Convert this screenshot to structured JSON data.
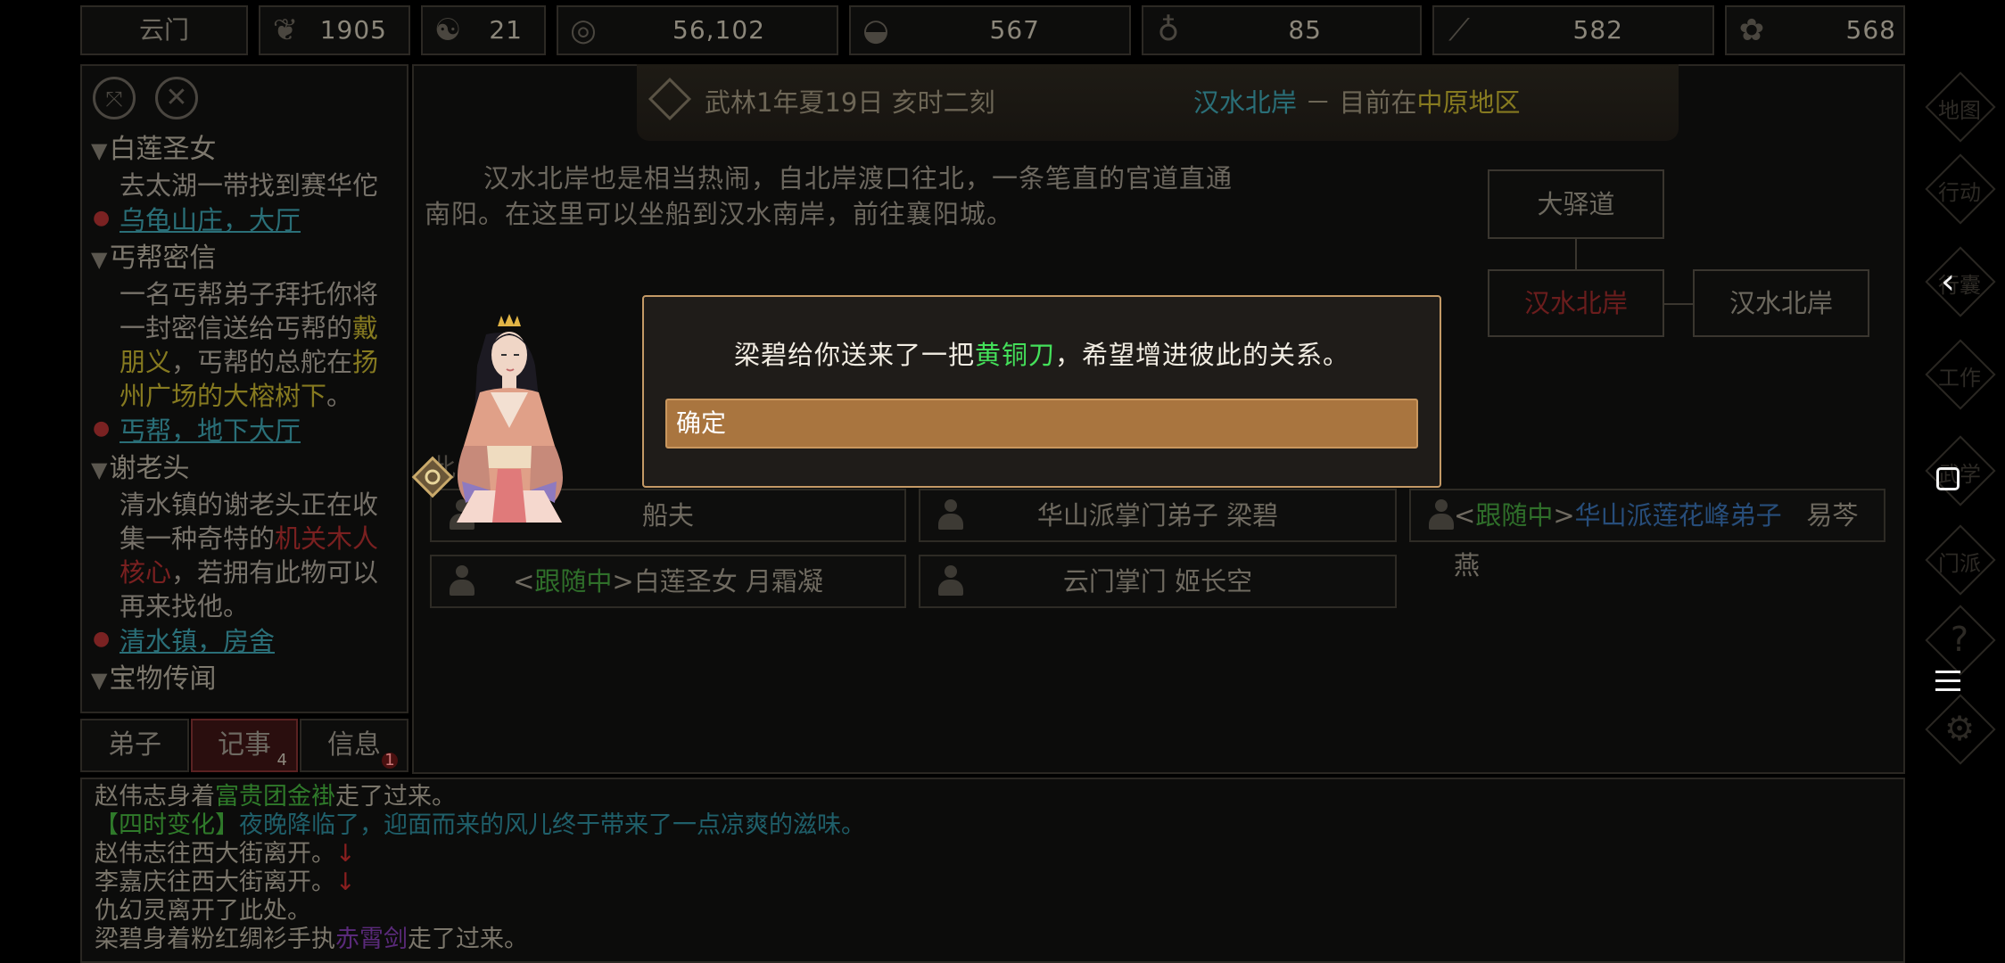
{
  "topbar": {
    "sect_name": "云门",
    "resources": [
      {
        "icon": "reputation-icon",
        "value": "1905"
      },
      {
        "icon": "yin-yang-icon",
        "value": "21"
      },
      {
        "icon": "coin-icon",
        "value": "56,102"
      },
      {
        "icon": "food-bowl-icon",
        "value": "567"
      },
      {
        "icon": "gourd-icon",
        "value": "85"
      },
      {
        "icon": "wood-icon",
        "value": "582"
      },
      {
        "icon": "ore-icon",
        "value": "568"
      }
    ]
  },
  "left_panel": {
    "quests": [
      {
        "title": "白莲圣女",
        "desc": "去太湖一带找到赛华佗",
        "location": "乌龟山庄，大厅"
      },
      {
        "title": "丐帮密信",
        "desc_parts": [
          "一名丐帮弟子拜托你将一封密信送给丐帮的",
          "戴朋义",
          "，丐帮的总舵在",
          "扬州广场的大榕树下",
          "。"
        ],
        "location": "丐帮，地下大厅"
      },
      {
        "title": "谢老头",
        "desc_parts": [
          "清水镇的谢老头正在收集一种奇特的",
          "机关木人核心",
          "，若拥有此物可以再来找他。"
        ],
        "location": "清水镇，房舍"
      },
      {
        "title": "宝物传闻"
      }
    ]
  },
  "tabs": [
    {
      "label": "弟子",
      "badge": ""
    },
    {
      "label": "记事",
      "badge": "4"
    },
    {
      "label": "信息",
      "badge": "1"
    }
  ],
  "header": {
    "date": "武林1年夏19日 亥时二刻",
    "location": "汉水北岸",
    "separator": "－",
    "region_prefix": "目前在",
    "region": "中原地区"
  },
  "description": "汉水北岸也是相当热闹，自北岸渡口往北，一条笔直的官道直通南阳。在这里可以坐船到汉水南岸，前往襄阳城。",
  "map": {
    "north": "大驿道",
    "current": "汉水北岸",
    "east": "汉水北岸"
  },
  "section_label": "此",
  "npcs": [
    {
      "prefix": "",
      "tag": "",
      "faction": "",
      "name": "船夫"
    },
    {
      "prefix": "",
      "tag": "",
      "faction": "",
      "name": "华山派掌门弟子 梁碧"
    },
    {
      "prefix": "<",
      "tag": "跟随中",
      "faction": "华山派莲花峰弟子",
      "name": "易芩燕"
    },
    {
      "prefix": "<",
      "tag": "跟随中",
      "faction": "",
      "name": "白莲圣女 月霜凝"
    },
    {
      "prefix": "",
      "tag": "",
      "faction": "",
      "name": "云门掌门 姬长空"
    }
  ],
  "dialog": {
    "message_before": "梁碧给你送来了一把",
    "item": "黄铜刀",
    "message_after": "，希望增进彼此的关系。",
    "confirm_label": "确定"
  },
  "log": [
    {
      "parts": [
        [
          "赵伟志身着",
          ""
        ],
        [
          "富贵团金褂",
          "green"
        ],
        [
          "走了过来。",
          ""
        ]
      ]
    },
    {
      "parts": [
        [
          "【四时变化】",
          "green"
        ],
        [
          "夜晚降临了，迎面而来的风儿终于带来了一点凉爽的滋味。",
          "teal"
        ]
      ]
    },
    {
      "parts": [
        [
          "赵伟志往西大街离开。",
          ""
        ],
        [
          "↓",
          "red"
        ]
      ]
    },
    {
      "parts": [
        [
          "李嘉庆往西大街离开。",
          ""
        ],
        [
          "↓",
          "red"
        ]
      ]
    },
    {
      "parts": [
        [
          "仇幻灵离开了此处。",
          ""
        ]
      ]
    },
    {
      "parts": [
        [
          "梁碧身着粉红绸衫手执",
          ""
        ],
        [
          "赤霄剑",
          "purple"
        ],
        [
          "走了过来。",
          ""
        ]
      ]
    }
  ],
  "side_nav": [
    "地图",
    "行动",
    "行囊",
    "工作",
    "武学",
    "门派",
    "?",
    "设置"
  ],
  "colors": {
    "dialog_border": "#c49a66",
    "confirm_button": "#a9753f",
    "item_highlight": "#44e05a",
    "location_link": "#2a6f78"
  }
}
